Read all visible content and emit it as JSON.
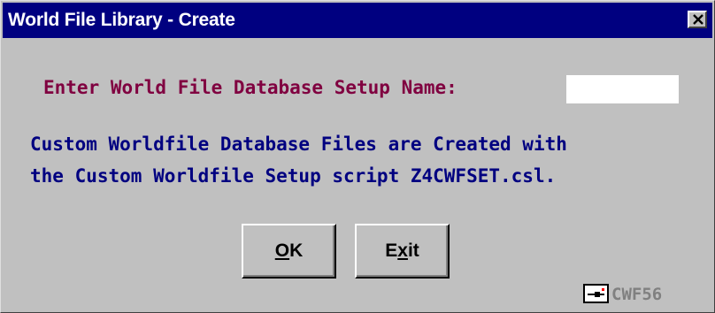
{
  "window": {
    "title": "World File Library - Create",
    "close_glyph": "×"
  },
  "prompt": {
    "label": "Enter World File Database Setup Name:",
    "value": "",
    "placeholder": ""
  },
  "info": {
    "line1": "Custom Worldfile Database Files are Created with",
    "line2": "the Custom Worldfile Setup script Z4CWFSET.csl."
  },
  "buttons": {
    "ok": {
      "mnemonic": "O",
      "rest": "K"
    },
    "exit": {
      "pre": "E",
      "mnemonic": "x",
      "rest": "it"
    }
  },
  "footer": {
    "icon": "tool-icon",
    "code": "CWF56"
  },
  "colors": {
    "titlebar": "#000080",
    "dialog_bg": "#c0c0c0",
    "prompt_text": "#800040",
    "info_text": "#000080",
    "footer_text": "#808080"
  }
}
